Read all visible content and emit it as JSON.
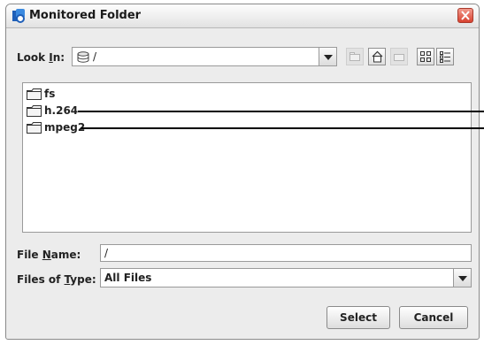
{
  "window": {
    "title": "Monitored Folder"
  },
  "look_in": {
    "label_prefix": "Look ",
    "label_mnemonic": "I",
    "label_suffix": "n:",
    "value": "/"
  },
  "files": [
    {
      "name": "fs"
    },
    {
      "name": "h.264"
    },
    {
      "name": "mpeg2"
    }
  ],
  "file_name": {
    "label_prefix": "File ",
    "label_mnemonic": "N",
    "label_suffix": "ame:",
    "value": "/"
  },
  "file_type": {
    "label_prefix": "Files of ",
    "label_mnemonic": "T",
    "label_suffix": "ype:",
    "value": "All Files"
  },
  "buttons": {
    "select": "Select",
    "cancel": "Cancel"
  }
}
